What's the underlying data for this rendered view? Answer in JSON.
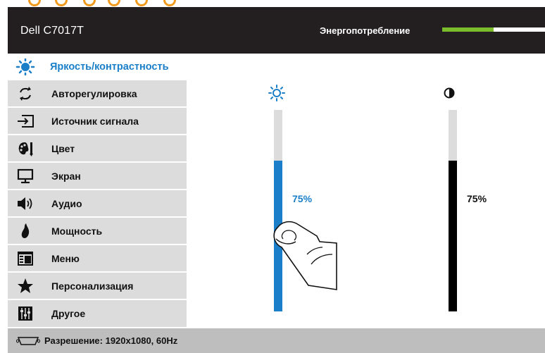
{
  "header": {
    "model": "Dell C7017T",
    "energy_label": "Энергопотребление",
    "energy_level": 0.5
  },
  "menu": {
    "items": [
      {
        "label": "Яркость/контрастность",
        "icon": "brightness-icon",
        "active": true
      },
      {
        "label": "Авторегулировка",
        "icon": "auto-adjust-icon"
      },
      {
        "label": "Источник сигнала",
        "icon": "input-source-icon"
      },
      {
        "label": "Цвет",
        "icon": "color-palette-icon"
      },
      {
        "label": "Экран",
        "icon": "monitor-icon"
      },
      {
        "label": "Аудио",
        "icon": "speaker-icon"
      },
      {
        "label": "Мощность",
        "icon": "power-flame-icon"
      },
      {
        "label": "Меню",
        "icon": "menu-window-icon"
      },
      {
        "label": "Персонализация",
        "icon": "star-icon"
      },
      {
        "label": "Другое",
        "icon": "sliders-icon"
      }
    ]
  },
  "brightness": {
    "icon": "sun-icon",
    "value_label": "75%",
    "value": 75,
    "color": "#1a7fc8"
  },
  "contrast": {
    "icon": "contrast-icon",
    "value_label": "75%",
    "value": 75,
    "color": "#000000"
  },
  "footer": {
    "icon": "vga-connector-icon",
    "resolution_text": "Разрешение: 1920x1080, 60Hz"
  },
  "colors": {
    "header_bg": "#231f20",
    "menu_bg": "#dcdcdc",
    "accent": "#1a7fc8",
    "energy_green": "#7abc2b",
    "footer_bg": "#bebebe"
  }
}
